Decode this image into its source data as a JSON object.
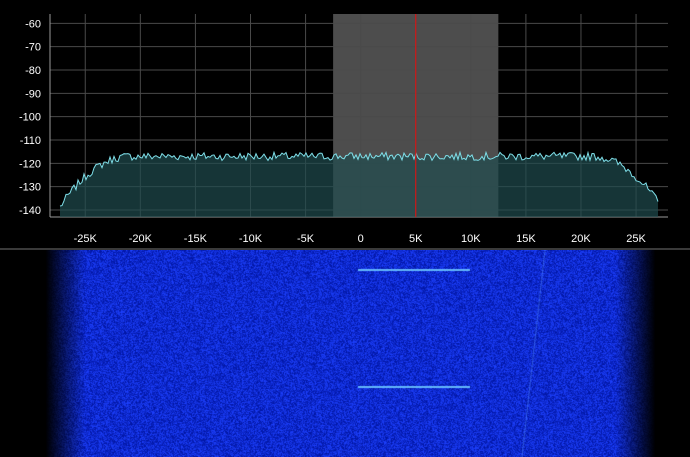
{
  "spectrum": {
    "y_ticks": [
      "-60",
      "-70",
      "-80",
      "-90",
      "-100",
      "-110",
      "-120",
      "-130",
      "-140"
    ],
    "x_ticks": [
      "-25K",
      "-20K",
      "-15K",
      "-10K",
      "-5K",
      "0",
      "5K",
      "10K",
      "15K",
      "20K",
      "25K"
    ],
    "ylim": [
      -143,
      -56
    ],
    "xlim": [
      -28.2,
      27.9
    ],
    "center_marker_khz": 5,
    "passband_khz": [
      -2.5,
      12.5
    ],
    "noise_floor_db": -117
  },
  "colors": {
    "background": "#000000",
    "grid": "#4a4a4a",
    "trace": "#7fe0ea",
    "fill": "#1f4c4f",
    "passband": "#5a5a5a",
    "marker": "#d01818",
    "waterfall": "#1330ff"
  },
  "waterfall": {
    "traces_khz": [
      [
        0,
        10
      ],
      [
        0,
        10
      ]
    ]
  }
}
